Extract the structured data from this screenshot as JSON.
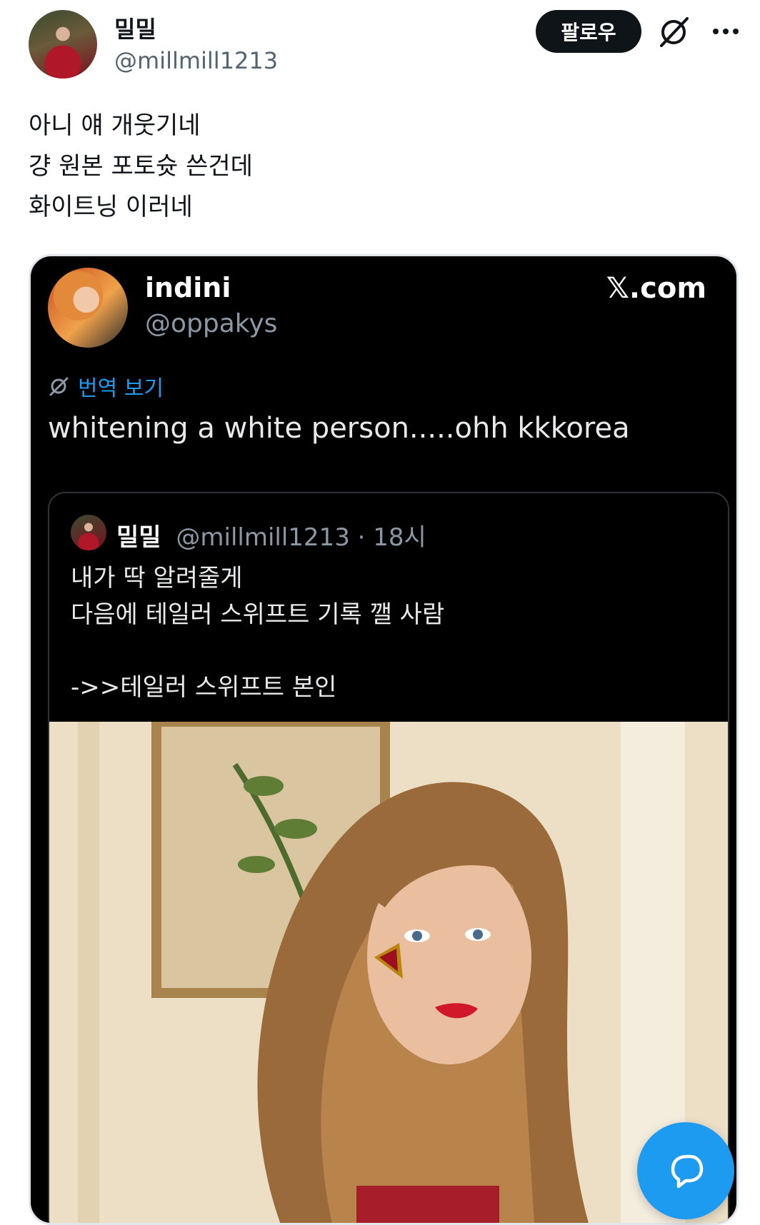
{
  "post": {
    "display_name": "밀밀",
    "handle": "@millmill1213",
    "follow_label": "팔로우",
    "text_lines": [
      "아니 얘 개웃기네",
      "걍 원본 포토슛 쓴건데",
      "화이트닝 이러네"
    ]
  },
  "embed": {
    "display_name": "indini",
    "handle": "@oppakys",
    "source_label": "𝕏.com",
    "translate_label": "번역 보기",
    "body": "whitening a white person.....ohh kkkorea",
    "quote": {
      "display_name": "밀밀",
      "handle": "@millmill1213",
      "time": "· 18시",
      "text_lines": [
        "내가 딱 알려줄게",
        "다음에 테일러 스위프트 기록 깰 사람",
        "",
        "->>테일러 스위프트 본인"
      ]
    }
  },
  "icons": {
    "grok": "grok-icon",
    "more": "more-icon",
    "translate": "translate-icon",
    "reply": "reply-bubble-icon"
  },
  "colors": {
    "accent": "#1d9bf0",
    "follow_bg": "#0f1419",
    "muted": "#536471"
  }
}
